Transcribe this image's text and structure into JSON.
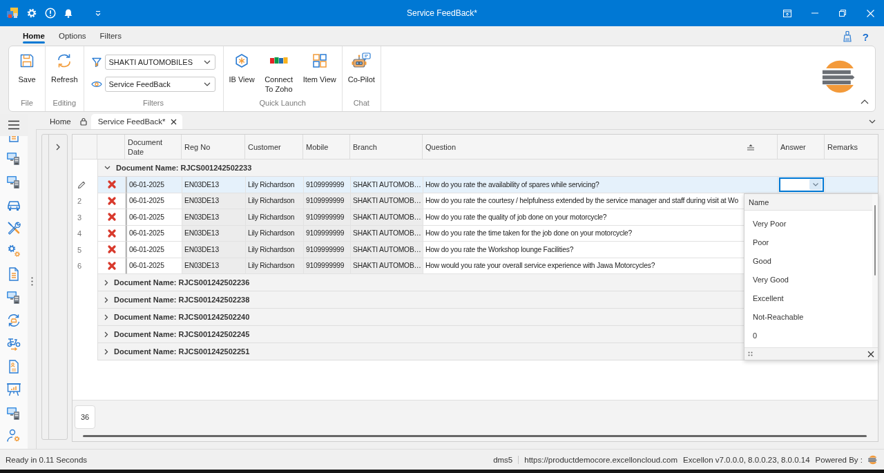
{
  "title_bar": {
    "title": "Service FeedBack*"
  },
  "ribbon": {
    "tabs": [
      {
        "label": "Home",
        "selected": true
      },
      {
        "label": "Options",
        "selected": false
      },
      {
        "label": "Filters",
        "selected": false
      }
    ],
    "help": "?",
    "groups": [
      {
        "kind": "buttons",
        "label": "File",
        "buttons": [
          "Save"
        ]
      },
      {
        "kind": "buttons",
        "label": "Editing",
        "buttons": [
          "Refresh"
        ]
      },
      {
        "kind": "filters",
        "label": "Filters",
        "dropdowns": [
          "SHAKTI AUTOMOBILES",
          "Service FeedBack"
        ]
      },
      {
        "kind": "buttons",
        "label": "Quick Launch",
        "buttons": [
          "IB View",
          "Connect To Zoho",
          "Item View"
        ]
      },
      {
        "kind": "buttons",
        "label": "Chat",
        "buttons": [
          "Co-Pilot"
        ]
      }
    ]
  },
  "document_tabs": [
    {
      "label": "Home",
      "selected": false,
      "pinned": true,
      "closable": false
    },
    {
      "label": "Service FeedBack*",
      "selected": true,
      "pinned": false,
      "closable": true
    }
  ],
  "grid": {
    "columns": [
      {
        "label": "Document Date",
        "kind": "text",
        "sorted": false
      },
      {
        "label": "Reg No",
        "kind": "readonly",
        "sorted": false
      },
      {
        "label": "Customer",
        "kind": "readonly",
        "sorted": false
      },
      {
        "label": "Mobile",
        "kind": "readonly",
        "sorted": false
      },
      {
        "label": "Branch",
        "kind": "readonly",
        "sorted": false
      },
      {
        "label": "Question",
        "kind": "text",
        "sorted": true
      },
      {
        "label": "Answer",
        "kind": "answer",
        "sorted": false
      },
      {
        "label": "Remarks",
        "kind": "text",
        "sorted": false
      }
    ],
    "groups": [
      {
        "title": "Document Name: RJCS001242502233",
        "expanded": true,
        "rows": [
          {
            "selected": true,
            "editing": true,
            "cells": [
              "06-01-2025",
              "EN03DE13",
              "Lily Richardson",
              "9109999999",
              "SHAKTI AUTOMOB…",
              "How do you rate the availability of spares while servicing?"
            ]
          },
          {
            "number": "2",
            "selected": false,
            "editing": false,
            "cells": [
              "06-01-2025",
              "EN03DE13",
              "Lily Richardson",
              "9109999999",
              "SHAKTI AUTOMOB…",
              "How do you rate the courtesy / helpfulness extended by the service manager and staff during visit at Wo"
            ]
          },
          {
            "number": "3",
            "selected": false,
            "editing": false,
            "cells": [
              "06-01-2025",
              "EN03DE13",
              "Lily Richardson",
              "9109999999",
              "SHAKTI AUTOMOB…",
              "How do you rate the quality of job done on your motorcycle?"
            ]
          },
          {
            "number": "4",
            "selected": false,
            "editing": false,
            "cells": [
              "06-01-2025",
              "EN03DE13",
              "Lily Richardson",
              "9109999999",
              "SHAKTI AUTOMOB…",
              "How do you rate the time taken for the job done on your motorcycle?"
            ]
          },
          {
            "number": "5",
            "selected": false,
            "editing": false,
            "cells": [
              "06-01-2025",
              "EN03DE13",
              "Lily Richardson",
              "9109999999",
              "SHAKTI AUTOMOB…",
              "How do you rate the Workshop lounge Facilities?"
            ]
          },
          {
            "number": "6",
            "selected": false,
            "editing": false,
            "cells": [
              "06-01-2025",
              "EN03DE13",
              "Lily Richardson",
              "9109999999",
              "SHAKTI AUTOMOB…",
              "How would you rate your overall service experience with Jawa Motorcycles?"
            ]
          }
        ]
      },
      {
        "title": "Document Name: RJCS001242502236",
        "expanded": false
      },
      {
        "title": "Document Name: RJCS001242502238",
        "expanded": false
      },
      {
        "title": "Document Name: RJCS001242502240",
        "expanded": false
      },
      {
        "title": "Document Name: RJCS001242502245",
        "expanded": false
      },
      {
        "title": "Document Name: RJCS001242502251",
        "expanded": false
      }
    ],
    "answer_dropdown": {
      "header": "Name",
      "options": [
        "Very Poor",
        "Poor",
        "Good",
        "Very Good",
        "Excellent",
        "Not-Reachable",
        "0"
      ]
    },
    "record_count": "36"
  },
  "status_bar": {
    "message": "Ready in 0.11 Seconds",
    "items": [
      "dms5",
      "https://productdemocore.excelloncloud.com",
      "Excellon v7.0.0.0, 8.0.0.23, 8.0.0.14",
      "Powered By :"
    ]
  }
}
